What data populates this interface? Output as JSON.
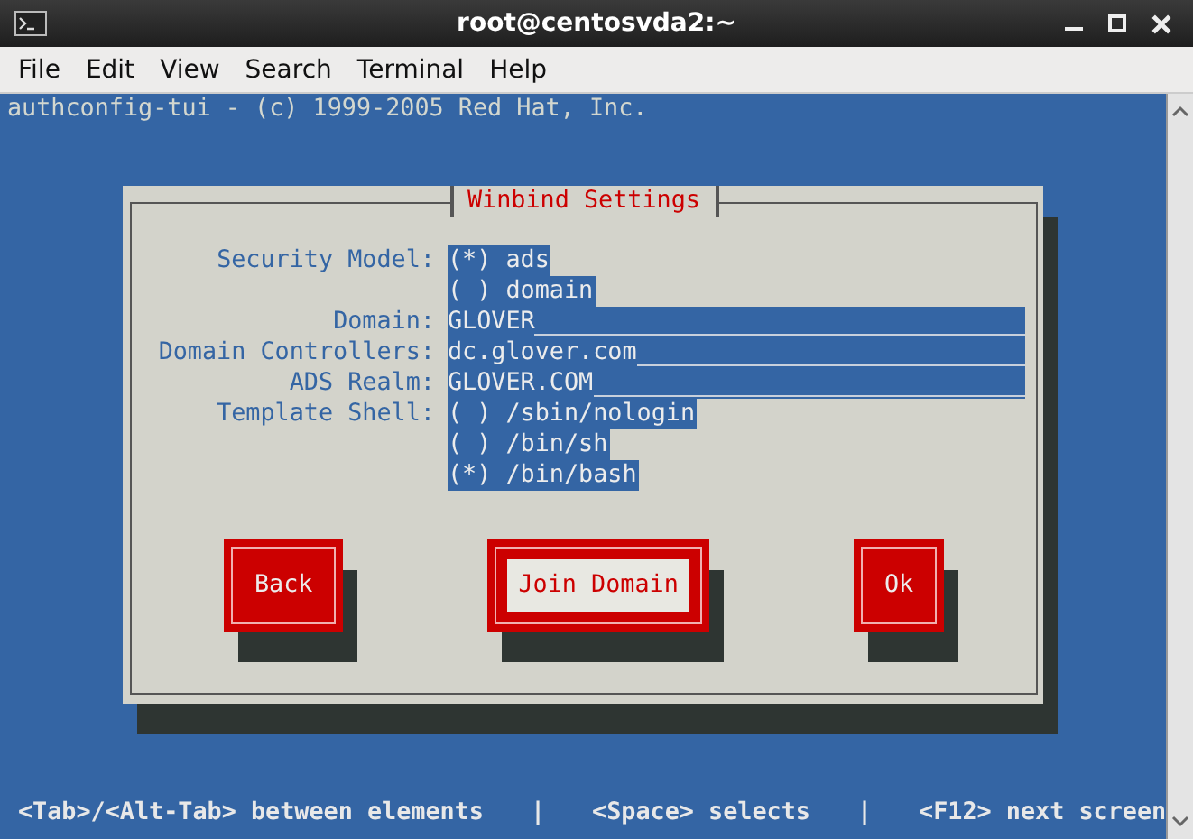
{
  "window": {
    "title": "root@centosvda2:~"
  },
  "menu": [
    "File",
    "Edit",
    "View",
    "Search",
    "Terminal",
    "Help"
  ],
  "header": "authconfig-tui - (c) 1999-2005 Red Hat, Inc.",
  "dialog": {
    "title": "Winbind Settings",
    "rows": [
      {
        "kind": "radio",
        "label": "Security Model:",
        "options": [
          "(*) ads",
          "( ) domain"
        ]
      },
      {
        "kind": "field",
        "label": "Domain:",
        "value": "GLOVER"
      },
      {
        "kind": "field",
        "label": "Domain Controllers:",
        "value": "dc.glover.com"
      },
      {
        "kind": "field",
        "label": "ADS Realm:",
        "value": "GLOVER.COM"
      },
      {
        "kind": "radio",
        "label": "Template Shell:",
        "options": [
          "( ) /sbin/nologin",
          "( ) /bin/sh",
          "(*) /bin/bash"
        ]
      }
    ],
    "buttons": [
      {
        "label": "Back",
        "focused": false
      },
      {
        "label": "Join Domain",
        "focused": true
      },
      {
        "label": "Ok",
        "focused": false
      }
    ]
  },
  "status_line": [
    "<Tab>/<Alt-Tab> between elements",
    "|",
    "<Space> selects",
    "|",
    "<F12> next screen"
  ]
}
